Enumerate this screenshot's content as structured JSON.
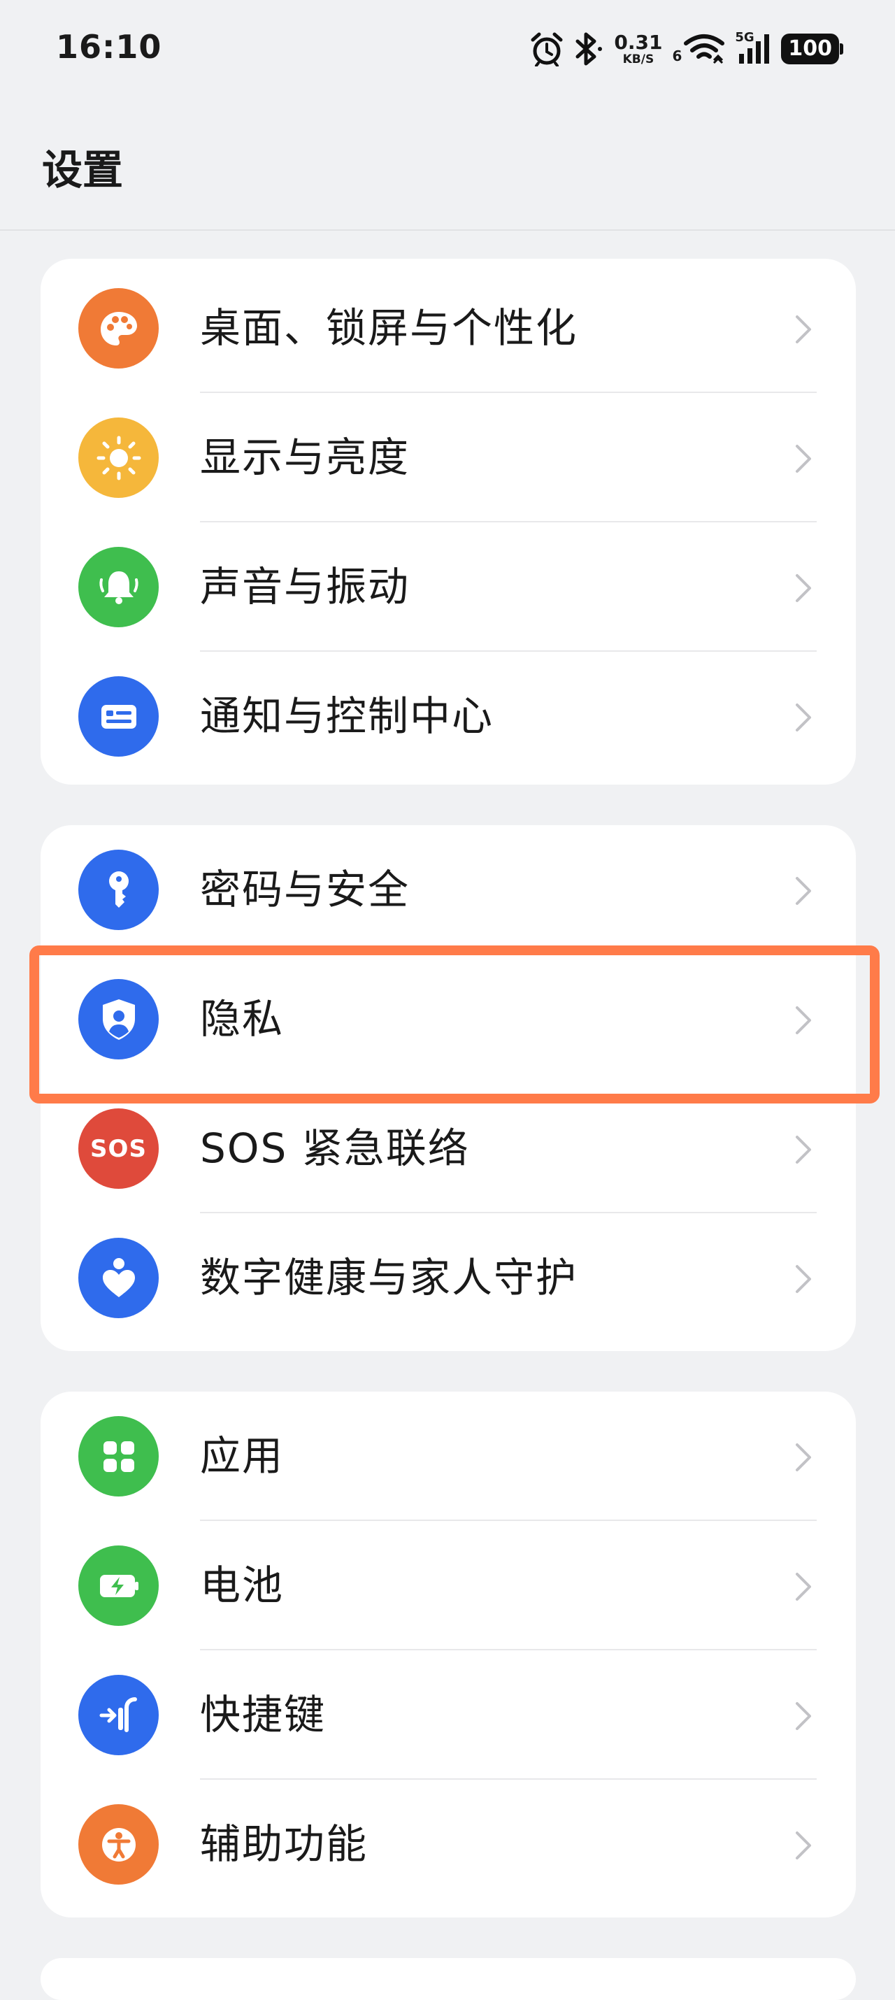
{
  "status_bar": {
    "time": "16:10",
    "net_speed_value": "0.31",
    "net_speed_unit": "KB/S",
    "wifi_label": "6",
    "cell_label": "5G",
    "battery": "100",
    "icons": [
      "alarm-icon",
      "bluetooth-icon",
      "wifi-icon",
      "cellular-signal-icon",
      "battery-icon"
    ]
  },
  "header": {
    "title": "设置"
  },
  "groups": [
    {
      "items": [
        {
          "label": "桌面、锁屏与个性化",
          "icon": "palette-icon",
          "color": "#f07a36"
        },
        {
          "label": "显示与亮度",
          "icon": "sun-icon",
          "color": "#f5b73b"
        },
        {
          "label": "声音与振动",
          "icon": "bell-icon",
          "color": "#3fbe4e"
        },
        {
          "label": "通知与控制中心",
          "icon": "notification-panel-icon",
          "color": "#2f6bec"
        }
      ]
    },
    {
      "items": [
        {
          "label": "密码与安全",
          "icon": "key-icon",
          "color": "#2f6bec"
        },
        {
          "label": "隐私",
          "icon": "privacy-shield-icon",
          "color": "#2f6bec"
        },
        {
          "label": "SOS 紧急联络",
          "icon": "sos-icon",
          "icon_text": "SOS",
          "color": "#df4a3b"
        },
        {
          "label": "数字健康与家人守护",
          "icon": "heart-person-icon",
          "color": "#2f6bec"
        }
      ]
    },
    {
      "items": [
        {
          "label": "应用",
          "icon": "apps-grid-icon",
          "color": "#3fbe4e"
        },
        {
          "label": "电池",
          "icon": "battery-charging-icon",
          "color": "#3fbe4e"
        },
        {
          "label": "快捷键",
          "icon": "shortcut-icon",
          "color": "#2f6bec"
        },
        {
          "label": "辅助功能",
          "icon": "accessibility-icon",
          "color": "#f07a36"
        }
      ]
    }
  ],
  "highlight": {
    "target": "隐私",
    "color": "#ff7b49"
  }
}
